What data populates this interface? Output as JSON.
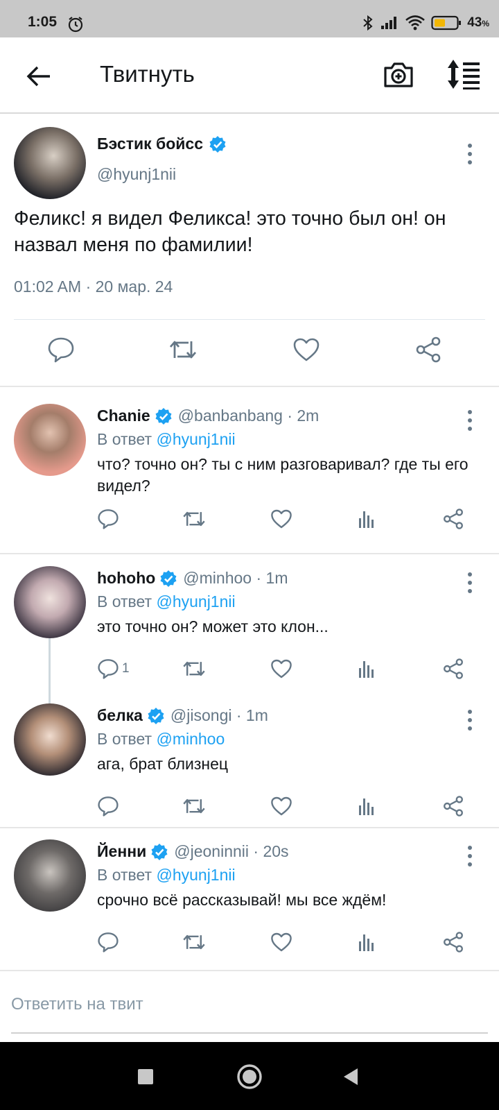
{
  "status_bar": {
    "time": "1:05",
    "battery_percent": "43",
    "battery_unit": "%",
    "icons": [
      "alarm-icon",
      "bluetooth-icon",
      "signal-icon",
      "wifi-icon",
      "battery-icon"
    ]
  },
  "header": {
    "title": "Твитнуть",
    "icons": [
      "back-arrow-icon",
      "camera-add-icon",
      "sort-icon"
    ]
  },
  "main_tweet": {
    "name": "Бэстик бойсс",
    "handle": "@hyunj1nii",
    "text": "Феликс! я видел Феликса! это точно был он! он назвал меня по фамилии!",
    "timestamp": "01:02 AM · 20 мар. 24"
  },
  "replies": [
    {
      "name": "Chanie",
      "handle": "@banbanbang",
      "time": "· 2m",
      "in_reply_prefix": "В ответ",
      "in_reply_to": "@hyunj1nii",
      "text": "что? точно он? ты с ним разговаривал? где ты его видел?",
      "reply_count": ""
    },
    {
      "name": "hohoho",
      "handle": "@minhoo",
      "time": "· 1m",
      "in_reply_prefix": "В ответ",
      "in_reply_to": "@hyunj1nii",
      "text": "это точно он? может это клон...",
      "reply_count": "1"
    },
    {
      "name": "белка",
      "handle": "@jisongi",
      "time": "· 1m",
      "in_reply_prefix": "В ответ",
      "in_reply_to": "@minhoo",
      "text": "ага, брат близнец",
      "reply_count": ""
    },
    {
      "name": "Йенни",
      "handle": "@jeoninnii",
      "time": "· 20s",
      "in_reply_prefix": "В ответ",
      "in_reply_to": "@hyunj1nii",
      "text": "срочно всё рассказывай! мы все ждём!",
      "reply_count": ""
    }
  ],
  "reply_box": {
    "placeholder": "Ответить на твит"
  },
  "colors": {
    "accent": "#1da1f2",
    "secondary_text": "#657786",
    "primary_text": "#14171a"
  }
}
